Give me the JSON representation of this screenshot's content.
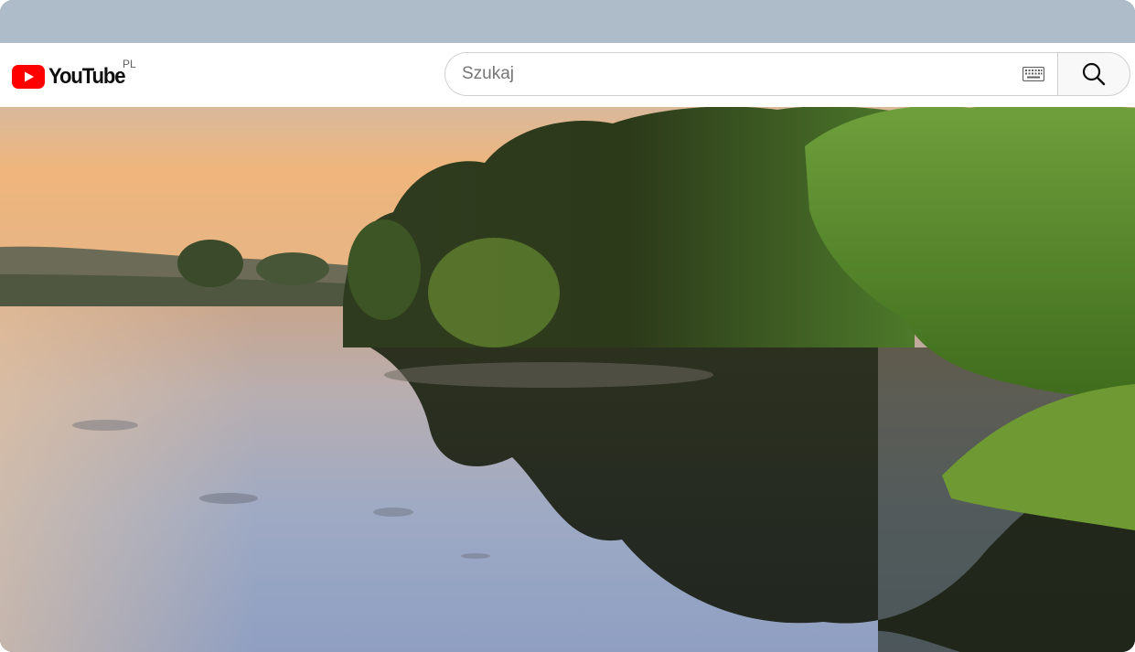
{
  "masthead": {
    "logo_text": "YouTube",
    "country_code": "PL",
    "brand_color": "#ff0000"
  },
  "search": {
    "placeholder": "Szukaj",
    "value": "",
    "keyboard_icon": "keyboard-icon",
    "button_icon": "search-icon"
  },
  "video": {
    "content": "video-frame"
  }
}
